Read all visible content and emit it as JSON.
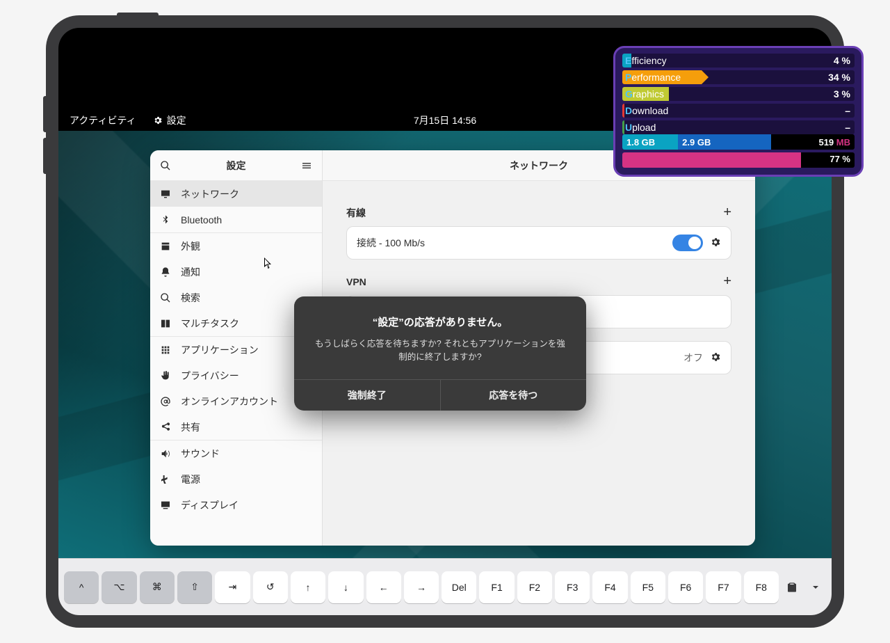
{
  "topbar": {
    "activities": "アクティビティ",
    "app_name": "設定",
    "clock": "7月15日  14:56"
  },
  "settings": {
    "window_title": "設定",
    "content_title": "ネットワーク",
    "sidebar": [
      {
        "icon": "monitor",
        "label": "ネットワーク",
        "selected": true
      },
      {
        "icon": "bluetooth",
        "label": "Bluetooth"
      },
      {
        "sep": true
      },
      {
        "icon": "appearance",
        "label": "外観"
      },
      {
        "icon": "bell",
        "label": "通知"
      },
      {
        "icon": "search",
        "label": "検索"
      },
      {
        "icon": "multitask",
        "label": "マルチタスク"
      },
      {
        "sep": true
      },
      {
        "icon": "apps",
        "label": "アプリケーション"
      },
      {
        "icon": "hand",
        "label": "プライバシー"
      },
      {
        "icon": "at",
        "label": "オンラインアカウント"
      },
      {
        "icon": "share",
        "label": "共有"
      },
      {
        "sep": true
      },
      {
        "icon": "sound",
        "label": "サウンド"
      },
      {
        "icon": "power",
        "label": "電源"
      },
      {
        "icon": "display",
        "label": "ディスプレイ"
      }
    ],
    "sections": {
      "wired_label": "有線",
      "wired_status": "接続 - 100 Mb/s",
      "vpn_label": "VPN",
      "proxy_off": "オフ"
    }
  },
  "dialog": {
    "title": "“設定”の応答がありません。",
    "message": "もうしばらく応答を待ちますか? それともアプリケーションを強制的に終了しますか?",
    "force_quit": "強制終了",
    "wait": "応答を待つ"
  },
  "stats": {
    "rows": [
      {
        "label": "Efficiency",
        "cap": "E",
        "value": "4 %",
        "pct": 4,
        "color": "#0aa3c2"
      },
      {
        "label": "Performance",
        "cap": "P",
        "value": "34 %",
        "pct": 34,
        "color": "#f59e0b",
        "arrow": true
      },
      {
        "label": "Graphics",
        "cap": "G",
        "value": "3 %",
        "pct": 20,
        "color": "#c0ca33"
      },
      {
        "label": "Download",
        "cap": "D",
        "value": "–",
        "pct": 0.8,
        "color": "#e53935"
      },
      {
        "label": "Upload",
        "cap": "U",
        "value": "–",
        "pct": 0.8,
        "color": "#43a047"
      }
    ],
    "memory": {
      "seg1": "1.8 GB",
      "seg1_pct": 24,
      "seg1_color": "#0aa3c2",
      "seg2": "2.9 GB",
      "seg2_pct": 40,
      "seg2_color": "#1565c0",
      "right": "519 MB",
      "right_color": "#d63384"
    },
    "disk": {
      "pct": 77,
      "label": "77 %"
    }
  },
  "keyboard": {
    "keys": [
      {
        "sym": "^",
        "gray": true,
        "name": "ctrl-key"
      },
      {
        "sym": "⌥",
        "gray": true,
        "name": "option-key"
      },
      {
        "sym": "⌘",
        "gray": true,
        "name": "command-key"
      },
      {
        "sym": "⇧",
        "gray": true,
        "name": "shift-key"
      },
      {
        "sym": "⇥",
        "name": "tab-key"
      },
      {
        "sym": "↺",
        "name": "refresh-key"
      },
      {
        "sym": "↑",
        "name": "up-key"
      },
      {
        "sym": "↓",
        "name": "down-key"
      },
      {
        "sym": "←",
        "name": "left-key"
      },
      {
        "sym": "→",
        "name": "right-key"
      },
      {
        "sym": "Del",
        "name": "del-key"
      },
      {
        "sym": "F1",
        "name": "f1-key"
      },
      {
        "sym": "F2",
        "name": "f2-key"
      },
      {
        "sym": "F3",
        "name": "f3-key"
      },
      {
        "sym": "F4",
        "name": "f4-key"
      },
      {
        "sym": "F5",
        "name": "f5-key"
      },
      {
        "sym": "F6",
        "name": "f6-key"
      },
      {
        "sym": "F7",
        "name": "f7-key"
      },
      {
        "sym": "F8",
        "name": "f8-key"
      }
    ]
  }
}
